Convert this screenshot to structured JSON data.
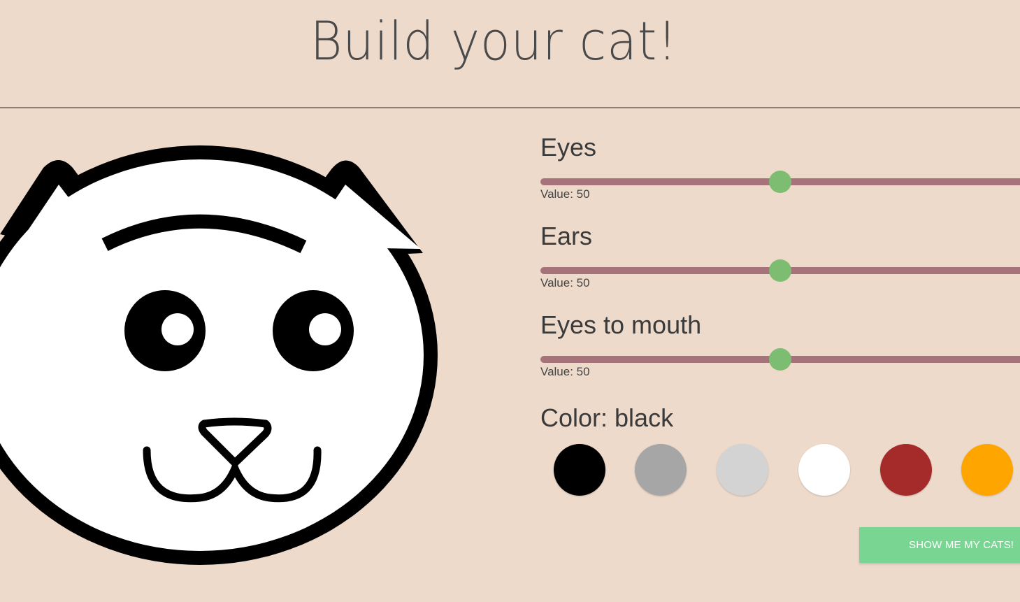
{
  "header": {
    "title": "Build your cat!"
  },
  "sliders": [
    {
      "label": "Eyes",
      "value_text": "Value: 50",
      "value": 50,
      "min": 0,
      "max": 100
    },
    {
      "label": "Ears",
      "value_text": "Value: 50",
      "value": 50,
      "min": 0,
      "max": 100
    },
    {
      "label": "Eyes to mouth",
      "value_text": "Value: 50",
      "value": 50,
      "min": 0,
      "max": 100
    }
  ],
  "color_picker": {
    "label": "Color: black",
    "selected": "black",
    "swatches": [
      {
        "name": "black",
        "hex": "#000000"
      },
      {
        "name": "gray",
        "hex": "#a6a6a6"
      },
      {
        "name": "lightgray",
        "hex": "#d3d3d3"
      },
      {
        "name": "white",
        "hex": "#ffffff"
      },
      {
        "name": "brown",
        "hex": "#a52a2a"
      },
      {
        "name": "orange",
        "hex": "#ffa500"
      }
    ]
  },
  "cat": {
    "fill_color": "#000000"
  },
  "actions": {
    "show_cats_label": "SHOW ME MY CATS!"
  },
  "colors": {
    "background": "#eddacb",
    "slider_track": "#a6737a",
    "slider_thumb": "#7cbd72",
    "button": "#79d692"
  }
}
